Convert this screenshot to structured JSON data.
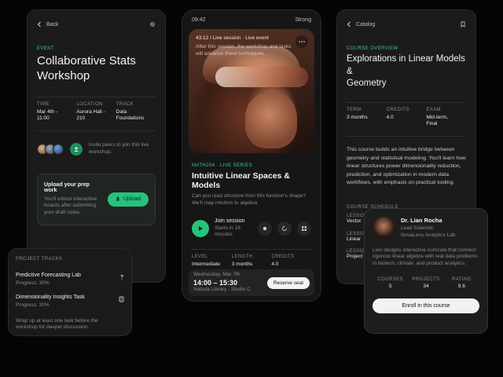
{
  "event": {
    "back_label": "Back",
    "eyebrow": "EVENT",
    "title_line1": "Collaborative Stats",
    "title_line2": "Workshop",
    "meta": [
      {
        "label": "TIME",
        "value": "Mar 4th - 11:00"
      },
      {
        "label": "LOCATION",
        "value": "Aurora Hall - 210"
      },
      {
        "label": "TRACK",
        "value": "Data Foundations"
      }
    ],
    "invite_text": "Invite peers to join this live workshop.",
    "upload_title": "Upload your prep work",
    "upload_desc": "You'll unlock interactive boards after submitting your draft notes.",
    "upload_button": "Upload"
  },
  "tracks": {
    "header": "PROJECT TRACKS",
    "items": [
      {
        "title": "Predictive Forecasting Lab",
        "progress": "Progress: 30%"
      },
      {
        "title": "Dimensionality Insights Task",
        "progress": "Progress: 30%"
      }
    ],
    "note": "Wrap up at least one task before the workshop for deeper discussion."
  },
  "session": {
    "status_time": "09:42",
    "status_right": "Strong",
    "hero_caption_1": "43:12 / Live session · Live event",
    "hero_caption_2": "After this session, the workshop and tasks will advance these techniques.",
    "eyebrow": "MATH204 · LIVE SERIES",
    "title": "Intuitive Linear Spaces & Models",
    "desc": "Can you read structure from this function's shape? We'll map intuition to algebra.",
    "join_title": "Join session",
    "join_sub_1": "Starts in 18",
    "join_sub_2": "minutes",
    "stats": [
      {
        "label": "LEVEL",
        "value": "Intermediate"
      },
      {
        "label": "LENGTH",
        "value": "3 months"
      },
      {
        "label": "CREDITS",
        "value": "4.0"
      }
    ],
    "slot_date": "Wednesday, Mar 7th",
    "slot_time": "14:00 – 15:30",
    "slot_place": "Nebula Library - Studio C",
    "reserve_button": "Reserve seat"
  },
  "catalog": {
    "back_label": "Catalog",
    "eyebrow": "COURSE OVERVIEW",
    "title_line1": "Explorations in Linear Models &",
    "title_line2": "Geometry",
    "meta": [
      {
        "label": "TERM",
        "value": "3 months"
      },
      {
        "label": "CREDITS",
        "value": "4.0"
      },
      {
        "label": "EXAM",
        "value": "Mid-term, Final"
      }
    ],
    "description": "This course builds an intuitive bridge between geometry and statistical modeling. You'll learn how linear structures power dimensionality reduction, prediction, and optimization in modern data workflows, with emphasis on practical tooling.",
    "schedule_header": "COURSE SCHEDULE",
    "schedule_items": [
      {
        "tag": "LESSON",
        "name": "Vector"
      },
      {
        "tag": "LESSON",
        "name": "Linear"
      },
      {
        "tag": "LESSON",
        "name": "Project"
      }
    ]
  },
  "instructor": {
    "name": "Dr. Lian Rocha",
    "role": "Lead Scientist, NovaLens Analytics Lab",
    "bio": "Lian designs interactive curricula that connect rigorous linear algebra with real data problems in biotech, climate, and product analytics.",
    "stats": [
      {
        "label": "COURSES",
        "value": "5"
      },
      {
        "label": "PROJECTS",
        "value": "34"
      },
      {
        "label": "RATING",
        "value": "9.6"
      }
    ],
    "enroll_button": "Enroll in this course"
  }
}
